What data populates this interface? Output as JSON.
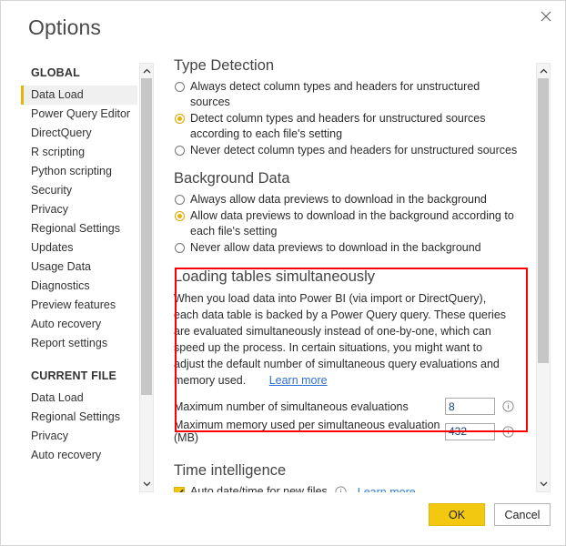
{
  "dialog": {
    "title": "Options",
    "close_icon": "close-icon"
  },
  "sidebar": {
    "groups": [
      {
        "title": "GLOBAL",
        "items": [
          {
            "label": "Data Load",
            "selected": true
          },
          {
            "label": "Power Query Editor",
            "selected": false
          },
          {
            "label": "DirectQuery",
            "selected": false
          },
          {
            "label": "R scripting",
            "selected": false
          },
          {
            "label": "Python scripting",
            "selected": false
          },
          {
            "label": "Security",
            "selected": false
          },
          {
            "label": "Privacy",
            "selected": false
          },
          {
            "label": "Regional Settings",
            "selected": false
          },
          {
            "label": "Updates",
            "selected": false
          },
          {
            "label": "Usage Data",
            "selected": false
          },
          {
            "label": "Diagnostics",
            "selected": false
          },
          {
            "label": "Preview features",
            "selected": false
          },
          {
            "label": "Auto recovery",
            "selected": false
          },
          {
            "label": "Report settings",
            "selected": false
          }
        ]
      },
      {
        "title": "CURRENT FILE",
        "items": [
          {
            "label": "Data Load",
            "selected": false
          },
          {
            "label": "Regional Settings",
            "selected": false
          },
          {
            "label": "Privacy",
            "selected": false
          },
          {
            "label": "Auto recovery",
            "selected": false
          }
        ]
      }
    ]
  },
  "content": {
    "type_detection": {
      "heading": "Type Detection",
      "options": [
        {
          "label": "Always detect column types and headers for unstructured sources",
          "checked": false
        },
        {
          "label": "Detect column types and headers for unstructured sources according to each file's setting",
          "checked": true
        },
        {
          "label": "Never detect column types and headers for unstructured sources",
          "checked": false
        }
      ]
    },
    "background_data": {
      "heading": "Background Data",
      "options": [
        {
          "label": "Always allow data previews to download in the background",
          "checked": false
        },
        {
          "label": "Allow data previews to download in the background according to each file's setting",
          "checked": true
        },
        {
          "label": "Never allow data previews to download in the background",
          "checked": false
        }
      ]
    },
    "loading_tables": {
      "heading": "Loading tables simultaneously",
      "description": "When you load data into Power BI (via import or DirectQuery), each data table is backed by a Power Query query. These queries are evaluated simultaneously instead of one-by-one, which can speed up the process. In certain situations, you might want to adjust the default number of simultaneous query evaluations and memory used.",
      "learn_more": "Learn more",
      "fields": [
        {
          "label": "Maximum number of simultaneous evaluations",
          "value": "8",
          "info_icon": "info-icon"
        },
        {
          "label": "Maximum memory used per simultaneous evaluation (MB)",
          "value": "432",
          "info_icon": "info-icon"
        }
      ],
      "highlight_color": "#ff0000"
    },
    "time_intelligence": {
      "heading": "Time intelligence",
      "checkbox_label": "Auto date/time for new files",
      "checkbox_checked": true,
      "info_icon": "info-icon",
      "learn_more": "Learn more"
    }
  },
  "footer": {
    "ok_label": "OK",
    "cancel_label": "Cancel"
  },
  "colors": {
    "accent": "#f2c811",
    "link": "#2b6fd4",
    "highlight": "#ff0000"
  }
}
